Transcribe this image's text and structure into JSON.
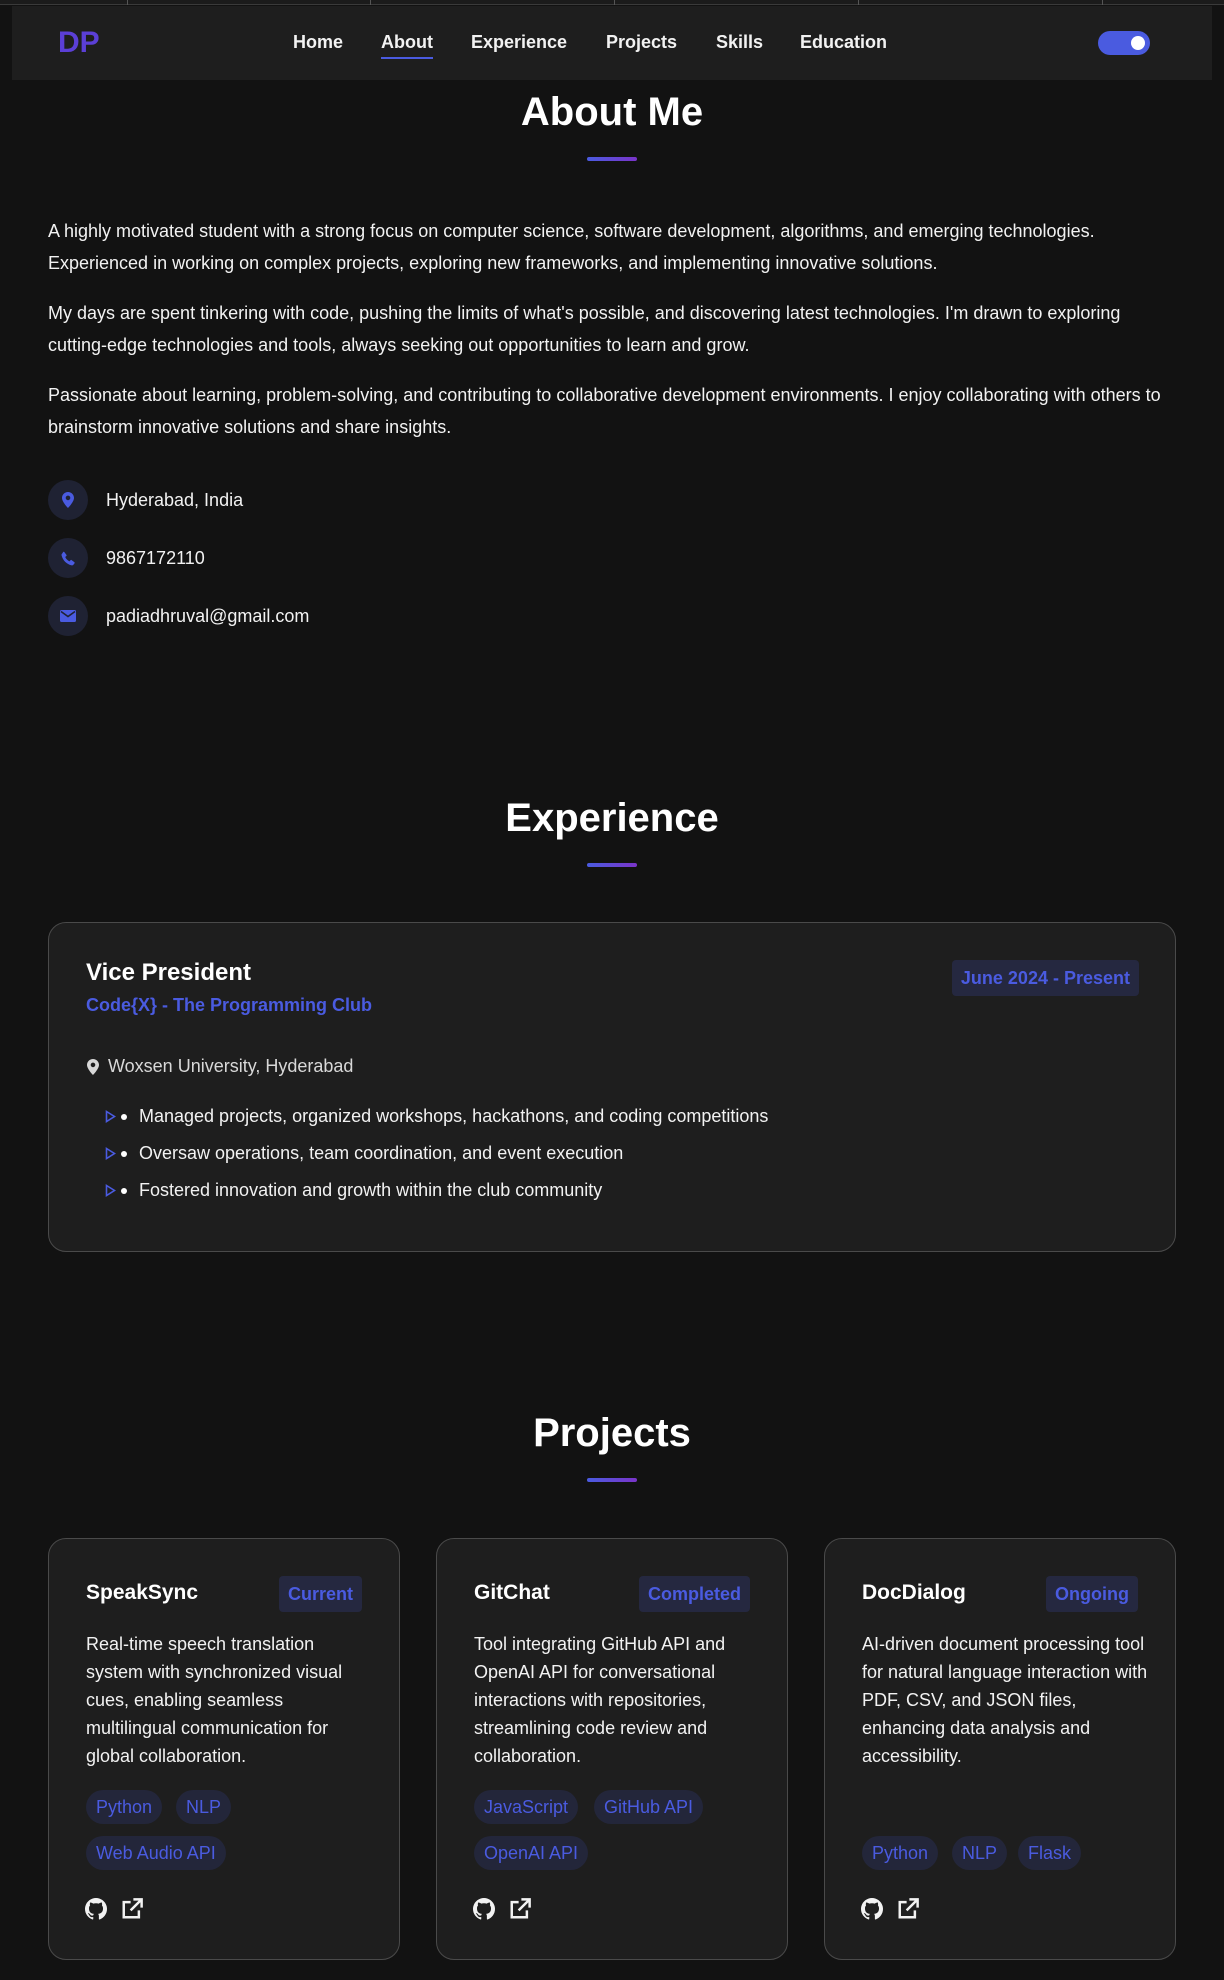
{
  "colors": {
    "accent": "#4a5be0",
    "logo": "#5b3fd6",
    "background": "#121212",
    "card": "#1e1e1e"
  },
  "nav": {
    "logo": "DP",
    "links": [
      "Home",
      "About",
      "Experience",
      "Projects",
      "Skills",
      "Education"
    ],
    "active": "About",
    "theme_toggle": "on"
  },
  "about": {
    "title": "About Me",
    "paragraphs": [
      "A highly motivated student with a strong focus on computer science, software development, algorithms, and emerging technologies. Experienced in working on complex projects, exploring new frameworks, and implementing innovative solutions.",
      "My days are spent tinkering with code, pushing the limits of what's possible, and discovering latest technologies. I'm drawn to exploring cutting-edge technologies and tools, always seeking out opportunities to learn and grow.",
      "Passionate about learning, problem-solving, and contributing to collaborative development environments. I enjoy collaborating with others to brainstorm innovative solutions and share insights."
    ],
    "contacts": [
      {
        "icon": "location-pin-icon",
        "text": "Hyderabad, India"
      },
      {
        "icon": "phone-icon",
        "text": "9867172110"
      },
      {
        "icon": "envelope-icon",
        "text": "padiadhruval@gmail.com"
      }
    ]
  },
  "experience": {
    "title": "Experience",
    "items": [
      {
        "role": "Vice President",
        "org": "Code{X} - The Programming Club",
        "date": "June 2024 - Present",
        "location": "Woxsen University, Hyderabad",
        "bullets": [
          "Managed projects, organized workshops, hackathons, and coding competitions",
          "Oversaw operations, team coordination, and event execution",
          "Fostered innovation and growth within the club community"
        ]
      }
    ]
  },
  "projects": {
    "title": "Projects",
    "items": [
      {
        "name": "SpeakSync",
        "status": "Current",
        "description": "Real-time speech translation system with synchronized visual cues, enabling seamless multilingual communication for global collaboration.",
        "tags": [
          "Python",
          "NLP",
          "Web Audio API"
        ]
      },
      {
        "name": "GitChat",
        "status": "Completed",
        "description": "Tool integrating GitHub API and OpenAI API for conversational interactions with repositories, streamlining code review and collaboration.",
        "tags": [
          "JavaScript",
          "GitHub API",
          "OpenAI API"
        ]
      },
      {
        "name": "DocDialog",
        "status": "Ongoing",
        "description": "AI-driven document processing tool for natural language interaction with PDF, CSV, and JSON files, enhancing data analysis and accessibility.",
        "tags": [
          "Python",
          "NLP",
          "Flask"
        ]
      }
    ]
  }
}
